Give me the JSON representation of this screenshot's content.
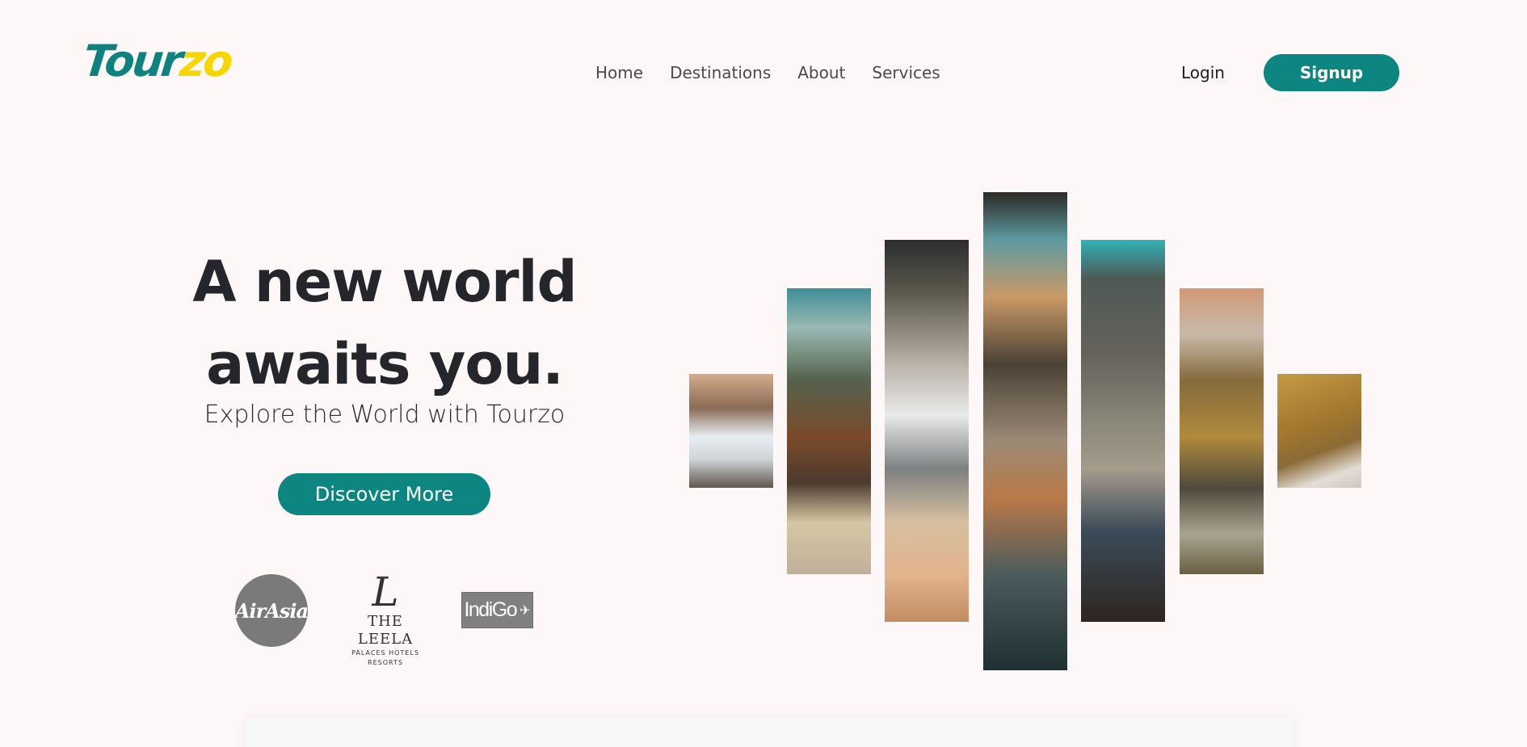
{
  "brand": {
    "logo_part1": "Tour",
    "logo_part2": "zo",
    "teal": "#0d8581",
    "yellow": "#f7d600"
  },
  "nav": {
    "items": [
      {
        "label": "Home"
      },
      {
        "label": "Destinations"
      },
      {
        "label": "About"
      },
      {
        "label": "Services"
      }
    ]
  },
  "auth": {
    "login_label": "Login",
    "signup_label": "Signup"
  },
  "hero": {
    "headline_line1": "A new world",
    "headline_line2": "awaits you.",
    "tagline": "Explore the World with Tourzo",
    "cta_label": "Discover More"
  },
  "partners": {
    "airasia": "AirAsia",
    "leela_mark": "L",
    "leela_name": "THE LEELA",
    "leela_sub": "PALACES HOTELS RESORTS",
    "indigo": "IndiGo"
  },
  "gallery": {
    "strips": [
      {
        "icon": "snowy-mountain-dashboard-photo"
      },
      {
        "icon": "boots-on-map-photo"
      },
      {
        "icon": "car-window-snow-photo"
      },
      {
        "icon": "van-interior-mountains-photo"
      },
      {
        "icon": "camper-blanket-photo"
      },
      {
        "icon": "meadow-feet-photo"
      },
      {
        "icon": "field-blanket-photo"
      }
    ]
  }
}
